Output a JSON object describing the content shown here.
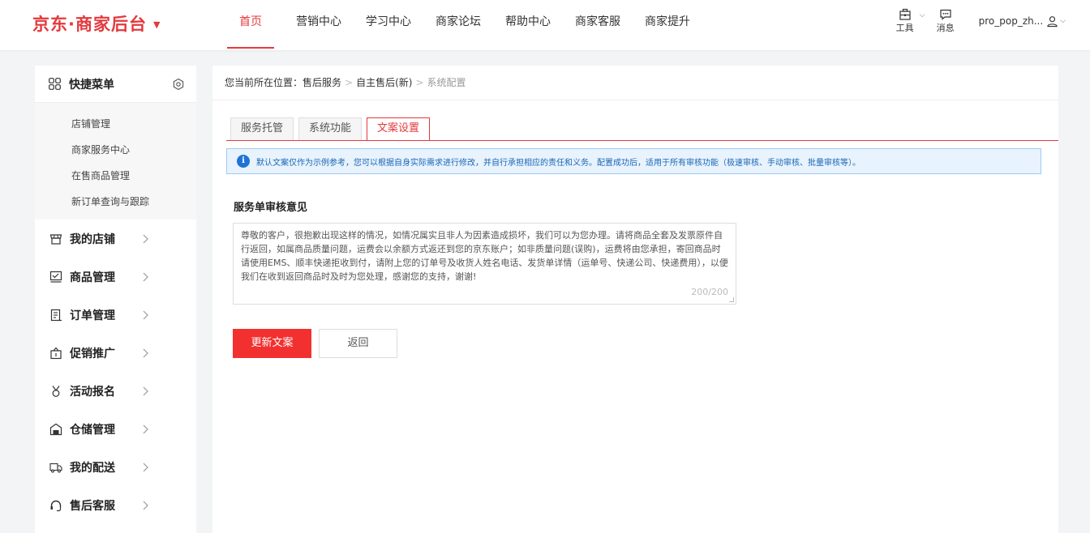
{
  "header": {
    "logo": "京东·商家后台",
    "nav": [
      "首页",
      "营销中心",
      "学习中心",
      "商家论坛",
      "帮助中心",
      "商家客服",
      "商家提升"
    ],
    "tools_label": "工具",
    "messages_label": "消息",
    "username": "pro_pop_zh..."
  },
  "sidebar": {
    "quick_title": "快捷菜单",
    "quick_items": [
      "店铺管理",
      "商家服务中心",
      "在售商品管理",
      "新订单查询与跟踪"
    ],
    "menu": [
      {
        "label": "我的店铺",
        "icon": "store-icon"
      },
      {
        "label": "商品管理",
        "icon": "product-icon"
      },
      {
        "label": "订单管理",
        "icon": "order-icon"
      },
      {
        "label": "促销推广",
        "icon": "promotion-icon"
      },
      {
        "label": "活动报名",
        "icon": "activity-icon"
      },
      {
        "label": "仓储管理",
        "icon": "warehouse-icon"
      },
      {
        "label": "我的配送",
        "icon": "delivery-icon"
      },
      {
        "label": "售后客服",
        "icon": "headset-icon"
      }
    ]
  },
  "breadcrumb": {
    "prefix": "您当前所在位置：",
    "items": [
      "售后服务",
      "自主售后(新)"
    ],
    "current": "系统配置"
  },
  "tabs": [
    "服务托管",
    "系统功能",
    "文案设置"
  ],
  "active_tab": 2,
  "notice": "默认文案仅作为示例参考，您可以根据自身实际需求进行修改，并自行承担相应的责任和义务。配置成功后，适用于所有审核功能（极速审核、手动审核、批量审核等）。",
  "form": {
    "section_title": "服务单审核意见",
    "text_value": "尊敬的客户，很抱歉出现这样的情况，如情况属实且非人为因素造成损坏，我们可以为您办理。请将商品全套及发票原件自行返回，如属商品质量问题，运费会以余额方式返还到您的京东账户；如非质量问题(误购)，运费将由您承担，寄回商品时请使用EMS、顺丰快递拒收到付，请附上您的订单号及收货人姓名电话、发货单详情（运单号、快递公司、快递费用），以便我们在收到返回商品时及时为您处理，感谢您的支持，谢谢!",
    "counter": "200/200",
    "submit_label": "更新文案",
    "back_label": "返回"
  },
  "colors": {
    "brand": "#e4393c",
    "primary_button": "#f23030",
    "notice_bg": "#e8f3fd",
    "notice_border": "#9fccf4"
  }
}
